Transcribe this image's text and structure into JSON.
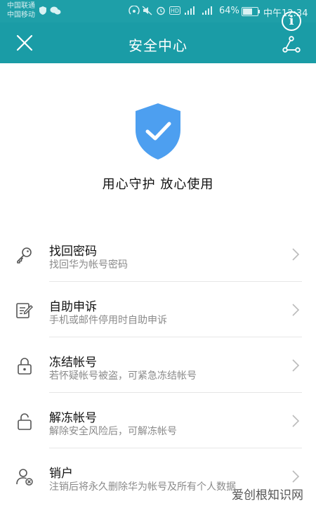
{
  "status_bar": {
    "carrier_1": "中国联通",
    "carrier_2": "中国移动",
    "battery": "64%",
    "time": "中午12:34"
  },
  "header": {
    "title": "安全中心",
    "close_icon": "close-icon",
    "share_icon": "share-icon",
    "info_icon": "info-icon",
    "info_glyph": "i"
  },
  "hero": {
    "icon": "shield-check-icon",
    "slogan": "用心守护 放心使用"
  },
  "menu": {
    "items": [
      {
        "title": "找回密码",
        "subtitle": "找回华为帐号密码",
        "icon": "key-icon"
      },
      {
        "title": "自助申诉",
        "subtitle": "手机或邮件停用时自助申诉",
        "icon": "edit-document-icon"
      },
      {
        "title": "冻结帐号",
        "subtitle": "若怀疑帐号被盗，可紧急冻结帐号",
        "icon": "lock-icon"
      },
      {
        "title": "解冻帐号",
        "subtitle": "解除安全风险后，可解冻帐号",
        "icon": "unlock-icon"
      },
      {
        "title": "销户",
        "subtitle": "注销后将永久删除华为帐号及所有个人数据",
        "icon": "remove-user-icon"
      }
    ]
  },
  "watermark": "爱创根知识网",
  "colors": {
    "header_bg": "#1a9ca6",
    "shield": "#4d9ff0",
    "text_primary": "#111111",
    "text_secondary": "#8a8a8a"
  }
}
